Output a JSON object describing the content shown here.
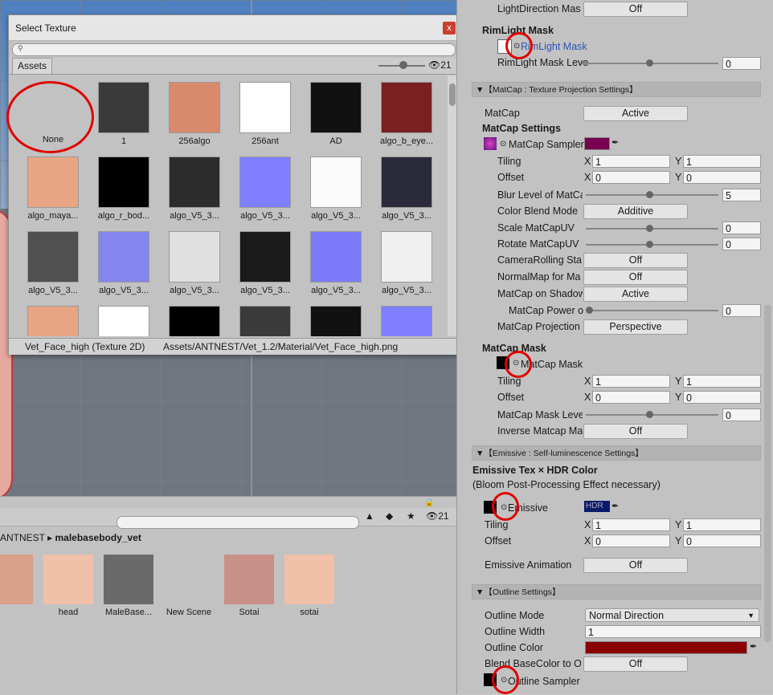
{
  "texture_window": {
    "title": "Select Texture",
    "close": "x",
    "tab": "Assets",
    "hidden_count": "21",
    "selected_name": "Vet_Face_high (Texture 2D)",
    "selected_path": "Assets/ANTNEST/Vet_1.2/Material/Vet_Face_high.png",
    "items": [
      {
        "label": "None",
        "color": "#c2c2c2"
      },
      {
        "label": "1",
        "color": "#3a3a3a"
      },
      {
        "label": "256algo",
        "color": "#d98a6c"
      },
      {
        "label": "256ant",
        "color": "#ffffff"
      },
      {
        "label": "AD",
        "color": "#111111"
      },
      {
        "label": "algo_b_eye...",
        "color": "#7a2020"
      },
      {
        "label": "algo_maya...",
        "color": "#e8a583"
      },
      {
        "label": "algo_r_bod...",
        "color": "#000000"
      },
      {
        "label": "algo_V5_3...",
        "color": "#2c2c2c"
      },
      {
        "label": "algo_V5_3...",
        "color": "#8080ff"
      },
      {
        "label": "algo_V5_3...",
        "color": "#fafafa"
      },
      {
        "label": "algo_V5_3...",
        "color": "#2a2a3a"
      },
      {
        "label": "algo_V5_3...",
        "color": "#505050"
      },
      {
        "label": "algo_V5_3...",
        "color": "#8585f0"
      },
      {
        "label": "algo_V5_3...",
        "color": "#e0e0e0"
      },
      {
        "label": "algo_V5_3...",
        "color": "#1a1a1a"
      },
      {
        "label": "algo_V5_3...",
        "color": "#7b7bfa"
      },
      {
        "label": "algo_V5_3...",
        "color": "#f0f0f0"
      },
      {
        "label": "",
        "color": "#e8a583"
      },
      {
        "label": "",
        "color": "#ffffff"
      },
      {
        "label": "",
        "color": "#000000"
      },
      {
        "label": "",
        "color": "#3a3a3a"
      },
      {
        "label": "",
        "color": "#111111"
      },
      {
        "label": "",
        "color": "#8080ff"
      }
    ]
  },
  "project": {
    "hidden_count": "21",
    "breadcrumb_root": "ANTNEST",
    "breadcrumb_leaf": "malebasebody_vet",
    "assets": [
      {
        "label": "",
        "color": "#d9a08a"
      },
      {
        "label": "head",
        "color": "#f0c0a8"
      },
      {
        "label": "MaleBase...",
        "color": "#6a6a6a"
      },
      {
        "label": "New Scene",
        "color": "#c2c2c2"
      },
      {
        "label": "Sotai",
        "color": "#c99088"
      },
      {
        "label": "sotai",
        "color": "#f0c0a8"
      }
    ]
  },
  "inspector": {
    "light_direction_label": "LightDirection Mas",
    "light_direction_value": "Off",
    "rimlight_header": "RimLight Mask",
    "rimlight_tex": "RimLight Mask",
    "rimlight_level_label": "RimLight Mask Leve",
    "rimlight_level_value": "0",
    "matcap_section": "【MatCap : Texture Projection Settings】",
    "matcap_label": "MatCap",
    "matcap_value": "Active",
    "matcap_settings": "MatCap Settings",
    "matcap_sampler": "MatCap Sampler",
    "tiling": "Tiling",
    "offset": "Offset",
    "x": "X",
    "y": "Y",
    "tiling_x": "1",
    "tiling_y": "1",
    "offset_x": "0",
    "offset_y": "0",
    "blur_label": "Blur Level of MatCa",
    "blur_value": "5",
    "blend_label": "Color Blend Mode",
    "blend_value": "Additive",
    "scale_label": "Scale MatCapUV",
    "scale_value": "0",
    "rotate_label": "Rotate MatCapUV",
    "rotate_value": "0",
    "camroll_label": "CameraRolling Sta",
    "camroll_value": "Off",
    "normalmap_label": "NormalMap for Ma",
    "normalmap_value": "Off",
    "shadow_label": "MatCap on Shadow",
    "shadow_value": "Active",
    "power_label": "MatCap Power o",
    "power_value": "0",
    "projection_label": "MatCap Projection",
    "projection_value": "Perspective",
    "mask_header": "MatCap Mask",
    "mask_tex": "MatCap Mask",
    "mask_tiling_x": "1",
    "mask_tiling_y": "1",
    "mask_offset_x": "0",
    "mask_offset_y": "0",
    "mask_level_label": "MatCap Mask Leve",
    "mask_level_value": "0",
    "inverse_label": "Inverse Matcap Ma",
    "inverse_value": "Off",
    "emissive_section": "【Emissive : Self-luminescence Settings】",
    "emissive_header": "Emissive Tex × HDR Color",
    "emissive_note": "(Bloom Post-Processing Effect necessary)",
    "emissive_tex": "Emissive",
    "hdr": "HDR",
    "em_tiling_x": "1",
    "em_tiling_y": "1",
    "em_offset_x": "0",
    "em_offset_y": "0",
    "em_anim_label": "Emissive Animation",
    "em_anim_value": "Off",
    "outline_section": "【Outline Settings】",
    "outline_mode_label": "Outline Mode",
    "outline_mode_value": "Normal Direction",
    "outline_width_label": "Outline Width",
    "outline_width_value": "1",
    "outline_color_label": "Outline Color",
    "blend_base_label": "Blend BaseColor to O",
    "blend_base_value": "Off",
    "outline_sampler": "Outline Sampler",
    "colors": {
      "matcap_swatch": "#7a0050",
      "outline_color": "#8a0000",
      "hdr_swatch": "#0a1a6a"
    }
  }
}
